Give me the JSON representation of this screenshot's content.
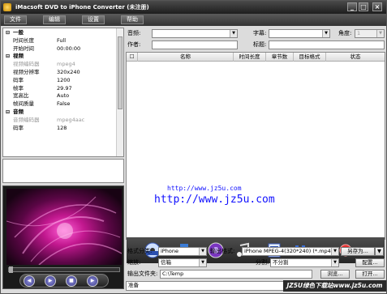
{
  "window": {
    "title": "iMacsoft DVD to iPhone Converter (未注册)",
    "controls": [
      "_",
      "□",
      "×"
    ]
  },
  "menu": [
    "文件",
    "编辑",
    "设置",
    "帮助"
  ],
  "properties": [
    {
      "type": "group",
      "label": "一般",
      "toggle": "⊟"
    },
    {
      "type": "row",
      "key": "时间长度",
      "value": "Full"
    },
    {
      "type": "row",
      "key": "开始时间",
      "value": "00:00:00"
    },
    {
      "type": "group",
      "label": "视频",
      "toggle": "⊟"
    },
    {
      "type": "row",
      "key": "视频编码器",
      "value": "mpeg4",
      "gray": true
    },
    {
      "type": "row",
      "key": "视频分辨率",
      "value": "320x240"
    },
    {
      "type": "row",
      "key": "码率",
      "value": "1200"
    },
    {
      "type": "row",
      "key": "帧率",
      "value": "29.97"
    },
    {
      "type": "row",
      "key": "宽高比",
      "value": "Auto"
    },
    {
      "type": "row",
      "key": "帧间质量",
      "value": "False"
    },
    {
      "type": "group",
      "label": "音频",
      "toggle": "⊟"
    },
    {
      "type": "row",
      "key": "音频编码器",
      "value": "mpeg4aac",
      "gray": true
    },
    {
      "type": "row",
      "key": "码率",
      "value": "128"
    }
  ],
  "top": {
    "audio_label": "音频:",
    "subtitle_label": "字幕:",
    "angle_label": "角度:",
    "angle_value": "1",
    "author_label": "作者:",
    "title_label": "标题:"
  },
  "grid": {
    "columns": [
      "名称",
      "时间长度",
      "章节数",
      "目标格式",
      "状态"
    ]
  },
  "watermark": {
    "small": "http://www.jz5u.com",
    "large": "http://www.jz5u.com"
  },
  "toolbar_icons": [
    "dvd-icon",
    "export-icon",
    "record-icon",
    "music-icon",
    "list-icon",
    "pause-icon",
    "stop-icon",
    "record-red-icon"
  ],
  "bottom": {
    "format_label": "格式分类:",
    "format_value": "iPhone",
    "output_format_label": "输出格式:",
    "output_format_value": "iPhone MPEG-4(320*240) (*.mp4)",
    "save_as_label": "另存为...",
    "zoom_label": "缩放:",
    "zoom_value": "信箱",
    "split_label": "分割:",
    "split_value": "不分割",
    "config_label": "配置...",
    "output_folder_label": "输出文件夹:",
    "output_folder_value": "C:\\Temp",
    "browse_label": "浏览...",
    "open_label": "打开...",
    "ready_text": "准备"
  },
  "site_badge": "JZ5U绿色下载站www.jz5u.com"
}
